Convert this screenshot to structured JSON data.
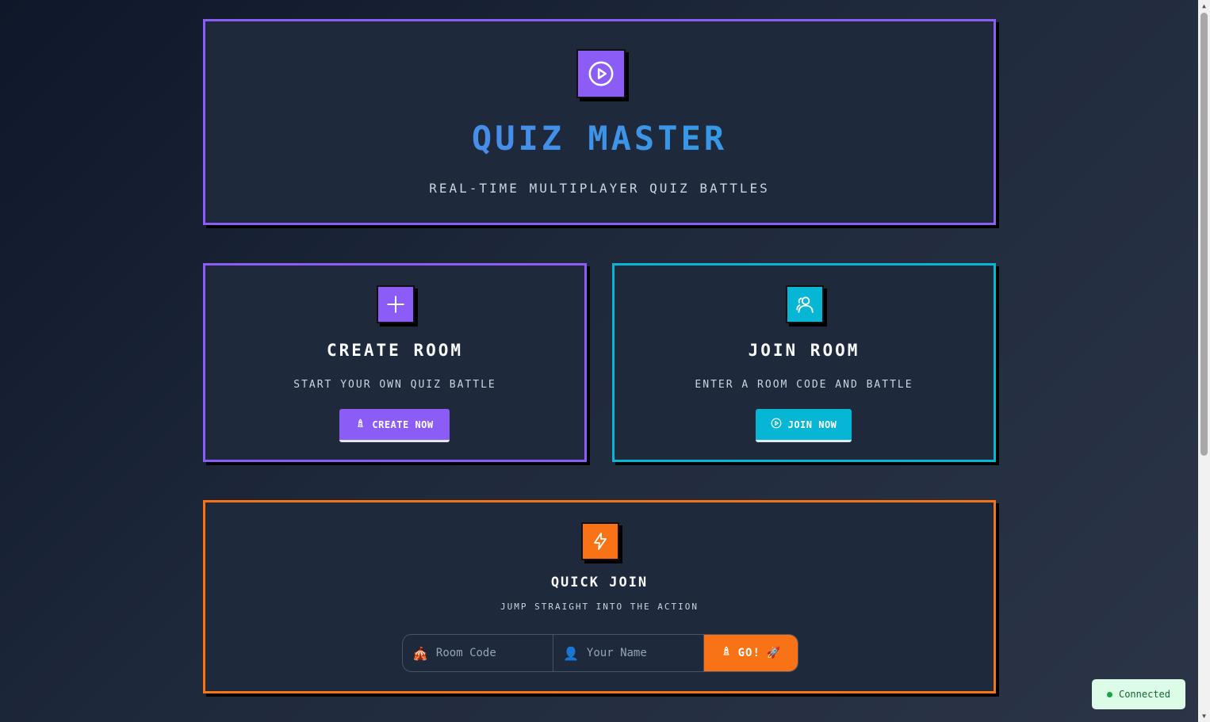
{
  "hero": {
    "icon": "play-circle-icon",
    "title": "QUIZ MASTER",
    "subtitle": "REAL-TIME MULTIPLAYER QUIZ BATTLES"
  },
  "create": {
    "icon": "plus-icon",
    "title": "CREATE ROOM",
    "subtitle": "START YOUR OWN QUIZ BATTLE",
    "button_icon": "rocket-icon",
    "button_label": "CREATE NOW"
  },
  "join": {
    "icon": "users-icon",
    "title": "JOIN ROOM",
    "subtitle": "ENTER A ROOM CODE AND BATTLE",
    "button_icon": "play-circle-icon",
    "button_label": "JOIN NOW"
  },
  "quick": {
    "icon": "lightning-icon",
    "title": "QUICK JOIN",
    "subtitle": "JUMP STRAIGHT INTO THE ACTION",
    "room_code_emoji": "🎪",
    "room_code_placeholder": "Room Code",
    "name_emoji": "👤",
    "name_placeholder": "Your Name",
    "go_label": "GO!",
    "go_emoji": "🚀"
  },
  "status": {
    "label": "Connected",
    "color": "#16a34a"
  },
  "colors": {
    "purple": "#8b5cf6",
    "cyan": "#06b6d4",
    "orange": "#f97316",
    "card_bg": "#1e293b"
  }
}
